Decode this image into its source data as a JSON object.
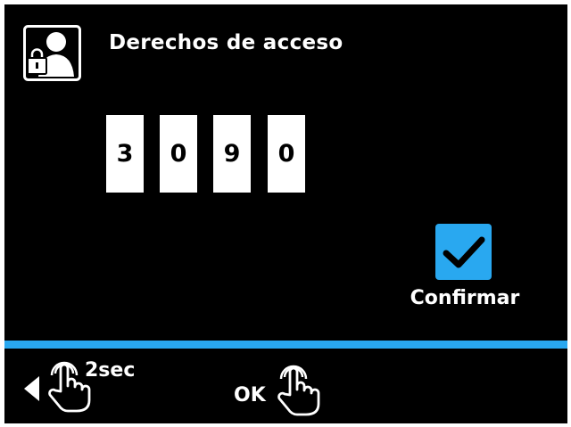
{
  "header": {
    "icon": "user-lock-icon",
    "title": "Derechos de acceso"
  },
  "code": {
    "digits": [
      "3",
      "0",
      "9",
      "0"
    ]
  },
  "confirm": {
    "icon": "checkmark-icon",
    "label": "Confirmar"
  },
  "footer": {
    "back": {
      "arrow_icon": "arrow-left-icon",
      "hand_icon": "tap-hand-icon",
      "hold_label": "2sec"
    },
    "ok": {
      "label": "OK",
      "hand_icon": "tap-hand-icon"
    }
  },
  "colors": {
    "background": "#000000",
    "accent": "#29a8f0",
    "text": "#ffffff"
  }
}
